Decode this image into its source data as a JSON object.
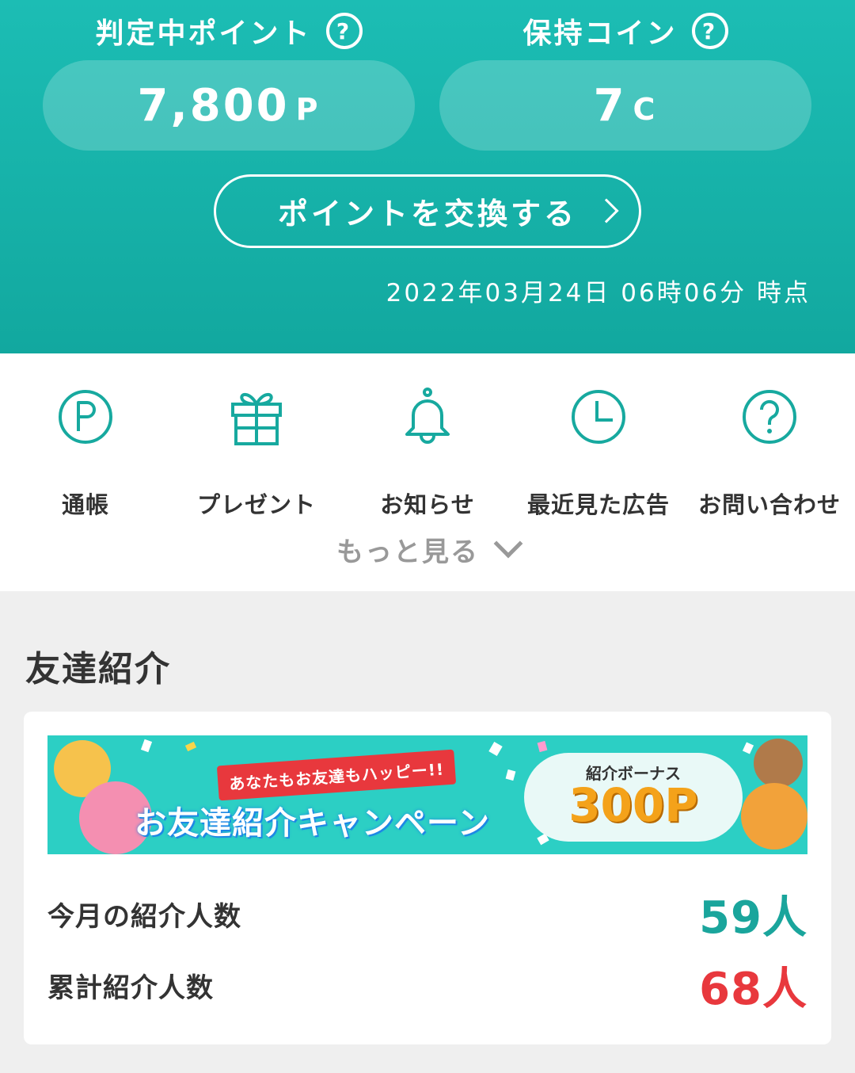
{
  "header": {
    "pending_points_label": "判定中ポイント",
    "coins_label": "保持コイン",
    "help_glyph": "?",
    "pending_points_value": "7,800",
    "pending_points_unit": "P",
    "coins_value": "7",
    "coins_unit": "C",
    "exchange_button_label": "ポイントを交換する",
    "timestamp": "2022年03月24日 06時06分 時点"
  },
  "menu": {
    "items": [
      {
        "label": "通帳",
        "icon": "p-circle-icon"
      },
      {
        "label": "プレゼント",
        "icon": "gift-icon"
      },
      {
        "label": "お知らせ",
        "icon": "bell-icon"
      },
      {
        "label": "最近見た広告",
        "icon": "clock-icon"
      },
      {
        "label": "お問い合わせ",
        "icon": "help-circle-icon"
      }
    ],
    "more_label": "もっと見る"
  },
  "referral": {
    "section_title": "友達紹介",
    "banner": {
      "ribbon_text": "あなたもお友達もハッピー!!",
      "campaign_text": "お友達紹介キャンペーン",
      "bonus_label": "紹介ボーナス",
      "bonus_value": "300P"
    },
    "this_month_label": "今月の紹介人数",
    "this_month_value": "59人",
    "total_label": "累計紹介人数",
    "total_value": "68人"
  },
  "colors": {
    "brand_teal": "#1cbdb4",
    "icon_teal": "#17a99f",
    "count_teal": "#1aa59c",
    "count_red": "#e8383d"
  }
}
